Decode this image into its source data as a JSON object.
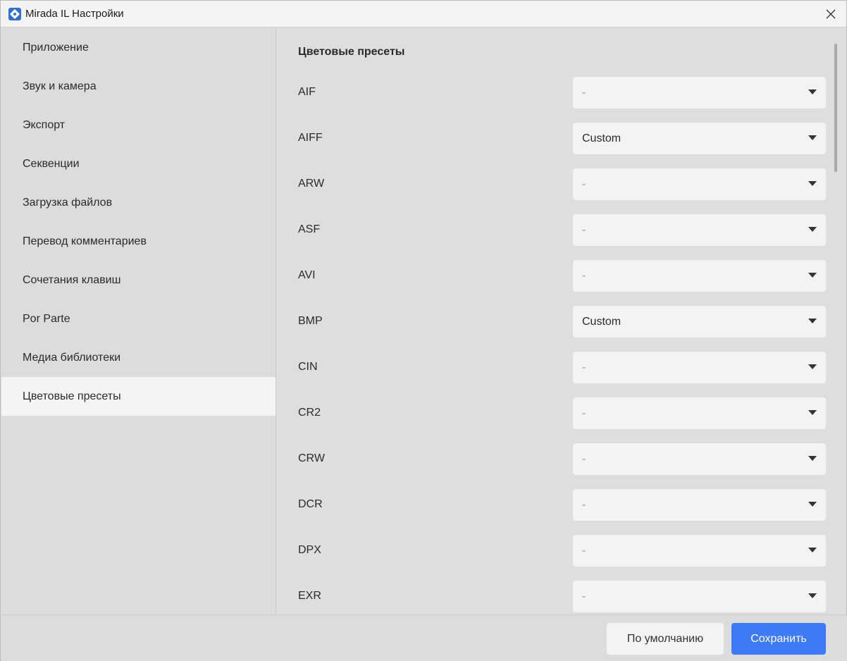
{
  "window": {
    "title": "Mirada IL Настройки"
  },
  "sidebar": {
    "items": [
      {
        "label": "Приложение"
      },
      {
        "label": "Звук и камера"
      },
      {
        "label": "Экспорт"
      },
      {
        "label": "Секвенции"
      },
      {
        "label": "Загрузка файлов"
      },
      {
        "label": "Перевод комментариев"
      },
      {
        "label": "Сочетания клавиш"
      },
      {
        "label": "Por Parte"
      },
      {
        "label": "Медиа библиотеки"
      },
      {
        "label": "Цветовые пресеты"
      }
    ],
    "active_item": "Цветовые пресеты"
  },
  "main": {
    "section_title": "Цветовые пресеты",
    "presets": [
      {
        "format": "AIF",
        "value": "-"
      },
      {
        "format": "AIFF",
        "value": "Custom"
      },
      {
        "format": "ARW",
        "value": "-"
      },
      {
        "format": "ASF",
        "value": "-"
      },
      {
        "format": "AVI",
        "value": "-"
      },
      {
        "format": "BMP",
        "value": "Custom"
      },
      {
        "format": "CIN",
        "value": "-"
      },
      {
        "format": "CR2",
        "value": "-"
      },
      {
        "format": "CRW",
        "value": "-"
      },
      {
        "format": "DCR",
        "value": "-"
      },
      {
        "format": "DPX",
        "value": "-"
      },
      {
        "format": "EXR",
        "value": "-"
      }
    ]
  },
  "footer": {
    "default_label": "По умолчанию",
    "save_label": "Сохранить"
  },
  "colors": {
    "accent": "#3d7af5",
    "active_item_bg": "#f4f4f4",
    "panel_bg": "#dedede",
    "select_bg": "#f3f3f3"
  },
  "icons": {
    "app": "app-logo-icon",
    "close": "close-icon",
    "dropdown": "chevron-down-icon"
  }
}
